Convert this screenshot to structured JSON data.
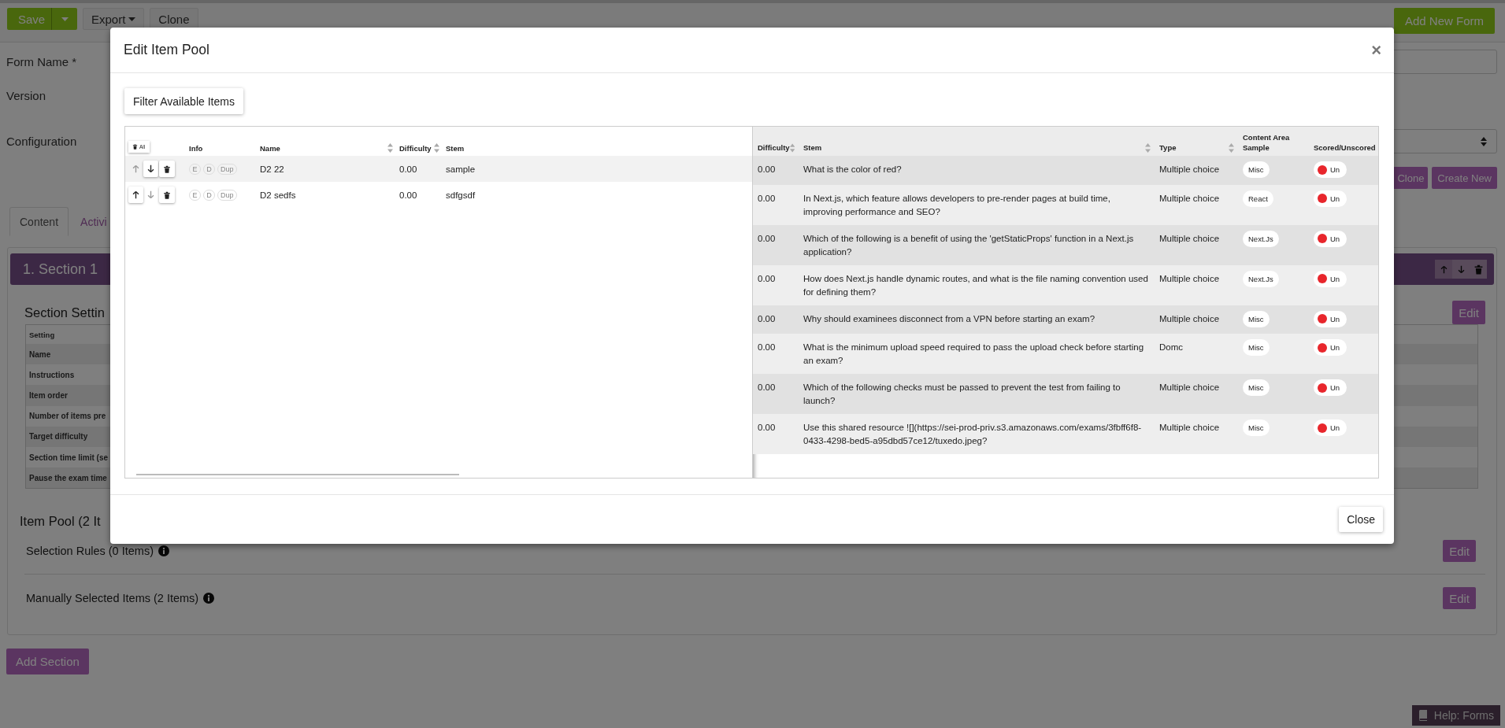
{
  "toolbar": {
    "save": "Save",
    "export": "Export",
    "clone": "Clone",
    "add_new_form": "Add New Form"
  },
  "form": {
    "fields": [
      {
        "label": "Form Name *",
        "kind": "input"
      },
      {
        "label": "Version",
        "kind": "plain"
      },
      {
        "label": "Configuration",
        "kind": "select"
      }
    ],
    "buttons": [
      "Clone",
      "Create New"
    ]
  },
  "tabs": [
    {
      "label": "Content",
      "selected": true
    },
    {
      "label": "Activi",
      "selected": false
    }
  ],
  "section": {
    "title": "1. Section 1",
    "settings_heading": "Section Settin",
    "settings_edit": "Edit",
    "settings_table": {
      "header": "Setting",
      "rows": [
        "Name",
        "Instructions",
        "Item order",
        "Number of items pre",
        "Target difficulty",
        "Section time limit (se",
        "Pause the exam time"
      ]
    },
    "item_pool_heading": "Item Pool (2 It",
    "pool_rows": [
      {
        "label": "Selection Rules (0 Items)",
        "button": "Edit"
      },
      {
        "label": "Manually Selected Items (2 Items)",
        "button": "Edit"
      }
    ]
  },
  "add_section": "Add Section",
  "help": "Help: Forms",
  "modal": {
    "title": "Edit Item Pool",
    "close_icon": "×",
    "filter_button": "Filter Available Items",
    "selected_table": {
      "clear_all": "All",
      "columns": [
        {
          "label": "Info",
          "sortable": false
        },
        {
          "label": "Name",
          "sortable": true
        },
        {
          "label": "Difficulty",
          "sortable": true
        },
        {
          "label": "Stem",
          "sortable": false
        }
      ],
      "rows": [
        {
          "up_disabled": true,
          "down_disabled": false,
          "badges": [
            "E",
            "D",
            "Dup"
          ],
          "name": "D2 22",
          "difficulty": "0.00",
          "stem": "sample"
        },
        {
          "up_disabled": false,
          "down_disabled": true,
          "badges": [
            "E",
            "D",
            "Dup"
          ],
          "name": "D2 sedfs",
          "difficulty": "0.00",
          "stem": "sdfgsdf"
        }
      ]
    },
    "available_table": {
      "columns": [
        {
          "label": "Difficulty",
          "sortable": true
        },
        {
          "label": "Stem",
          "sortable": true
        },
        {
          "label": "Type",
          "sortable": true
        },
        {
          "label": "Content Area Sample",
          "sortable": false
        },
        {
          "label": "Scored/Unscored",
          "sortable": false
        }
      ],
      "rows": [
        {
          "difficulty": "0.00",
          "stem": "What is the color of red?",
          "type": "Multiple choice",
          "content_area": "Misc",
          "scored": false,
          "scored_label": "Un"
        },
        {
          "difficulty": "0.00",
          "stem": "In Next.js, which feature allows developers to pre-render pages at build time, improving performance and SEO?",
          "type": "Multiple choice",
          "content_area": "React",
          "scored": false,
          "scored_label": "Un"
        },
        {
          "difficulty": "0.00",
          "stem": "Which of the following is a benefit of using the 'getStaticProps' function in a Next.js application?",
          "type": "Multiple choice",
          "content_area": "Next.Js",
          "scored": false,
          "scored_label": "Un"
        },
        {
          "difficulty": "0.00",
          "stem": "How does Next.js handle dynamic routes, and what is the file naming convention used for defining them?",
          "type": "Multiple choice",
          "content_area": "Next.Js",
          "scored": false,
          "scored_label": "Un"
        },
        {
          "difficulty": "0.00",
          "stem": "Why should examinees disconnect from a VPN before starting an exam?",
          "type": "Multiple choice",
          "content_area": "Misc",
          "scored": false,
          "scored_label": "Un"
        },
        {
          "difficulty": "0.00",
          "stem": "What is the minimum upload speed required to pass the upload check before starting an exam?",
          "type": "Domc",
          "content_area": "Misc",
          "scored": false,
          "scored_label": "Un"
        },
        {
          "difficulty": "0.00",
          "stem": "Which of the following checks must be passed to prevent the test from failing to launch?",
          "type": "Multiple choice",
          "content_area": "Misc",
          "scored": false,
          "scored_label": "Un"
        },
        {
          "difficulty": "0.00",
          "stem": "Use this shared resource ![](https://sei-prod-priv.s3.amazonaws.com/exams/3fbff6f8-0433-4298-bed5-a95dbd57ce12/tuxedo.jpeg?",
          "type": "Multiple choice",
          "content_area": "Misc",
          "scored": false,
          "scored_label": "Un"
        }
      ]
    },
    "close_button": "Close"
  }
}
